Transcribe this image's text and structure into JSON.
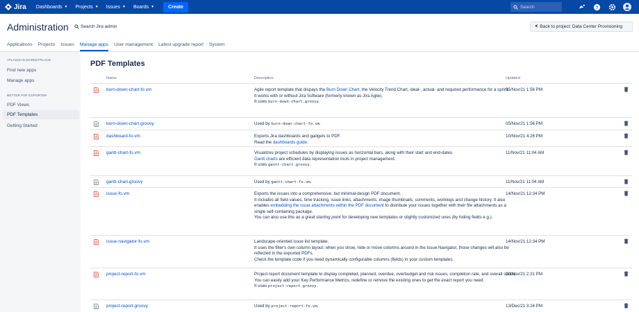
{
  "topnav": {
    "brand": "Jira",
    "items": [
      {
        "label": "Dashboards"
      },
      {
        "label": "Projects"
      },
      {
        "label": "Issues"
      },
      {
        "label": "Boards"
      }
    ],
    "create_label": "Create",
    "search_placeholder": "Search",
    "accent": "#0747a6"
  },
  "header": {
    "title": "Administration",
    "search_label": "Search Jira admin",
    "back_label": "Back to project: Data Center Provisioning"
  },
  "tabs": [
    {
      "label": "Applications"
    },
    {
      "label": "Projects"
    },
    {
      "label": "Issues"
    },
    {
      "label": "Manage apps",
      "active": true
    },
    {
      "label": "User management"
    },
    {
      "label": "Latest upgrade report"
    },
    {
      "label": "System"
    }
  ],
  "sidebar": {
    "sections": [
      {
        "title": "ATLASSIAN MARKETPLACE",
        "items": [
          {
            "label": "Find new apps"
          },
          {
            "label": "Manage apps"
          }
        ]
      },
      {
        "title": "BETTER PDF EXPORTER",
        "items": [
          {
            "label": "PDF Views"
          },
          {
            "label": "PDF Templates",
            "active": true
          },
          {
            "label": "Getting Started"
          }
        ]
      }
    ]
  },
  "main": {
    "title": "PDF Templates",
    "columns": {
      "name": "Name",
      "description": "Description",
      "updated": "Updated"
    },
    "rows": [
      {
        "type": "pdf",
        "name": "burn-down-chart-fo.vm",
        "updated": "05/Nov/21 1:56 PM",
        "desc": [
          [
            {
              "t": "Agile report template that dispays the "
            },
            {
              "t": "Burn Down Chart",
              "link": true
            },
            {
              "t": ", the Velocity Trend Chart, ideal-, actual- and required performance for a sprint."
            }
          ],
          [
            {
              "t": "It works with or without Jira Software (formerly known as Jira Agile)."
            }
          ],
          [
            {
              "t": "It uses "
            },
            {
              "t": "burn-down-chart.groovy",
              "code": true
            },
            {
              "t": "."
            }
          ]
        ]
      },
      {
        "type": "groovy",
        "name": "burn-down-chart.groovy",
        "updated": "05/Nov/21 1:56 PM",
        "desc": [
          [
            {
              "t": "Used by "
            },
            {
              "t": "burn-down-chart-fo.vm",
              "code": true
            },
            {
              "t": "."
            }
          ]
        ]
      },
      {
        "type": "pdf",
        "name": "dashboard-fo.vm",
        "updated": "10/Nov/21 4:26 PM",
        "desc": [
          [
            {
              "t": "Exports Jira dashboards and gadgets to PDF."
            }
          ],
          [
            {
              "t": "Read the "
            },
            {
              "t": "dashboards guide",
              "link": true
            },
            {
              "t": "."
            }
          ]
        ]
      },
      {
        "type": "pdf",
        "name": "gantt-chart-fo.vm",
        "updated": "11/Nov/21 11:04 AM",
        "desc": [
          [
            {
              "t": "Visualizes project schedules by displaying issues as horizontal bars, along with their start and end-dates."
            }
          ],
          [
            {
              "t": "Gantt charts",
              "link": true
            },
            {
              "t": " are efficient data representation tools in project management."
            }
          ],
          [
            {
              "t": "It uses "
            },
            {
              "t": "gantt-chart.groovy",
              "code": true
            },
            {
              "t": "."
            }
          ]
        ]
      },
      {
        "type": "groovy",
        "name": "gantt-chart.groovy",
        "updated": "11/Nov/21 11:04 AM",
        "desc": [
          [
            {
              "t": "Used by "
            },
            {
              "t": "gantt-chart-fo.vm",
              "code": true
            },
            {
              "t": "."
            }
          ]
        ]
      },
      {
        "type": "pdf",
        "name": "issue-fo.vm",
        "updated": "14/Nov/21 12:34 PM",
        "desc": [
          [
            {
              "t": "Exports the issues into a comprehensive, but minimal-design PDF document."
            }
          ],
          [
            {
              "t": "It includes all field values, time tracking, issue links, attachments, image thumbnails, comments, worklogs and change history. It also enables "
            },
            {
              "t": "embedding the issue attachments within the PDF document",
              "link": true
            },
            {
              "t": " to distribute your issues together with their file attachments as a single self-containing package."
            }
          ],
          [
            {
              "t": "You can also use this as "
            },
            {
              "t": "a great starting point",
              "em": true
            },
            {
              "t": " for developing new templates or slightly customized ones (by hiding fields e.g.)."
            }
          ]
        ]
      },
      {
        "type": "pdf",
        "name": "issue-navigator-fo.vm",
        "updated": "14/Nov/21 12:34 PM",
        "desc": [
          [
            {
              "t": "Landscape-oriented issue list template."
            }
          ],
          [
            {
              "t": "It uses the filter's own column layout: when you show, hide or move columns around in the Issue Navigator, those changes will also be reflected in the exported PDFs."
            }
          ],
          [
            {
              "t": "Check the template code if you need dynamically configurable columns (fields) in your custom templates."
            }
          ]
        ]
      },
      {
        "type": "pdf",
        "name": "project-report-fo.vm",
        "updated": "20/Nov/21 2:31 PM",
        "desc": [
          [
            {
              "t": "Project report document template to display completed, planned, overdue, overbudget and risk issues, completion rate, and overall status."
            }
          ],
          [
            {
              "t": "You can easily add your Key Performance Metrics, redefine or remove the existing ones to get the "
            },
            {
              "t": "exact",
              "em": true
            },
            {
              "t": " report you need."
            }
          ],
          [
            {
              "t": "It uses "
            },
            {
              "t": "project-report.groovy",
              "code": true
            },
            {
              "t": "."
            }
          ]
        ]
      },
      {
        "type": "groovy",
        "name": "project-report.groovy",
        "updated": "13/Dec/21 3:24 PM",
        "desc": [
          [
            {
              "t": "Used by "
            },
            {
              "t": "project-report-fo.vm",
              "code": true
            },
            {
              "t": "."
            }
          ]
        ]
      }
    ]
  }
}
